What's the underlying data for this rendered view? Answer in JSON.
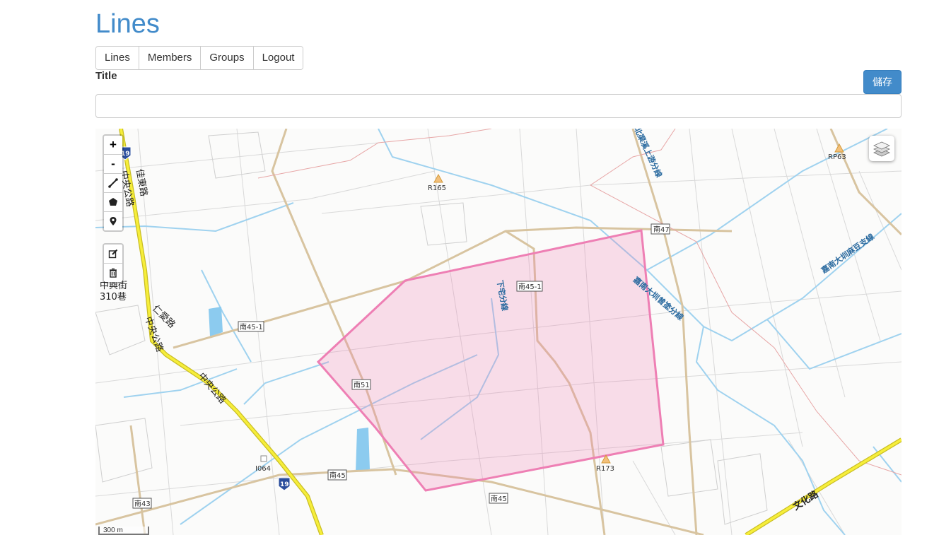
{
  "header": {
    "title": "Lines"
  },
  "nav": {
    "items": [
      {
        "label": "Lines"
      },
      {
        "label": "Members"
      },
      {
        "label": "Groups"
      },
      {
        "label": "Logout"
      }
    ]
  },
  "form": {
    "title_label": "Title",
    "title_value": "",
    "save_label": "儲存"
  },
  "map": {
    "zoom_in": "+",
    "zoom_out": "-",
    "scale_label": "300 m",
    "draw_tools": [
      "polyline-icon",
      "polygon-icon",
      "marker-icon"
    ],
    "edit_tools": [
      "edit-icon",
      "trash-icon"
    ],
    "polygon_color": "#ee7fb4",
    "labels": {
      "r165": "R165",
      "rp63": "RP63",
      "r173": "R173",
      "i064": "I064",
      "nan47": "南47",
      "nan45_1_a": "南45-1",
      "nan45_1_b": "南45-1",
      "nan51": "南51",
      "nan45_a": "南45",
      "nan45_b": "南45",
      "nan43": "南43",
      "shield19_a": "19",
      "shield19_b": "19",
      "zhongyang": "中央公路",
      "jiadong": "佳東路",
      "zhongxing": "中興街",
      "num310": "310巷",
      "renai": "仁愛路",
      "zhongyang2": "中央公路",
      "zhongyang3": "中央公路",
      "wenhua": "文化路",
      "jiaxin": "嘉南大圳麻豆支線",
      "jiaxin2": "嘉南大圳曾塗分線",
      "shangyou": "北渠溪上游分線",
      "xiaji": "下宅分線"
    }
  }
}
